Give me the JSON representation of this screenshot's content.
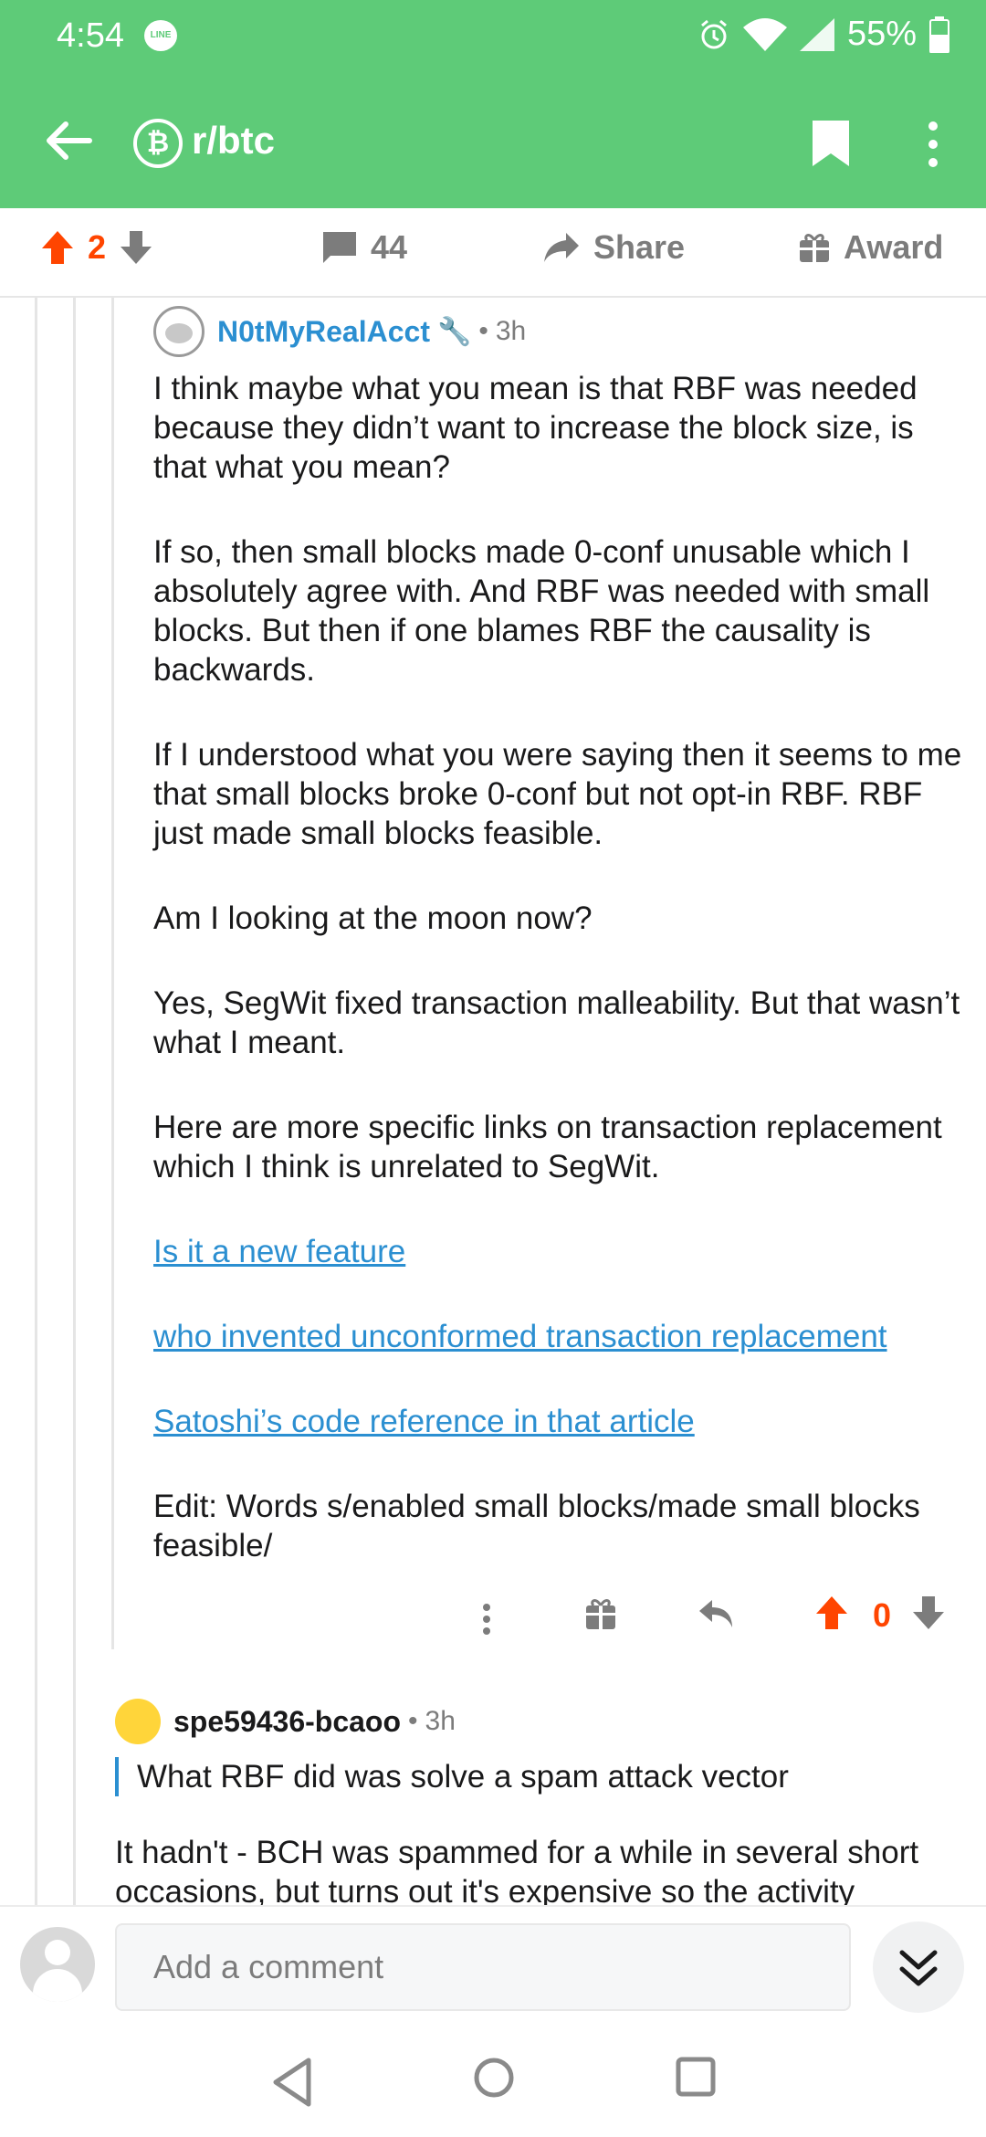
{
  "status_bar": {
    "time": "4:54",
    "notification_app": "LINE",
    "battery": "55%"
  },
  "toolbar": {
    "subreddit_icon_letter": "₿",
    "subreddit": "r/btc"
  },
  "post_actions": {
    "vote_count": "2",
    "comment_count": "44",
    "share_label": "Share",
    "award_label": "Award"
  },
  "comment1": {
    "author": "N0tMyRealAcct",
    "separator": "•",
    "age": "3h",
    "paragraphs": [
      "I think maybe what you mean is that RBF was needed because they didn’t want to increase the block size, is that what you mean?",
      "If so, then small blocks made 0-conf unusable which I absolutely agree with. And RBF was needed with small blocks. But then if one blames RBF the causality is backwards.",
      "If I understood what you were saying then it seems to me that small blocks broke 0-conf but not opt-in RBF. RBF just made small blocks feasible.",
      "Am I looking at the moon now?",
      "Yes, SegWit fixed transaction malleability. But that wasn’t what I meant.",
      "Here are more specific links on transaction replacement which I think is unrelated to SegWit."
    ],
    "links": [
      "Is it a new feature",
      "who invented unconformed transaction replacement",
      "Satoshi’s code reference in that article"
    ],
    "edit_note": "Edit: Words s/enabled small blocks/made small blocks feasible/",
    "vote_count": "0"
  },
  "comment2": {
    "author": "spe59436-bcaoo",
    "separator": "•",
    "age": "3h",
    "quote": "What RBF did was solve a spam attack vector",
    "body": "It hadn't - BCH was spammed for a while in several short occasions, but turns out it's expensive so the activity"
  },
  "comment_bar": {
    "placeholder": "Add a comment"
  },
  "colors": {
    "app_bar": "#5ecb78",
    "upvote": "#ff4500",
    "link": "#2b8fd1",
    "muted": "#7c7c7c"
  },
  "icons": [
    "back-arrow-icon",
    "bitcoin-icon",
    "bookmark-icon",
    "more-vert-icon",
    "upvote-icon",
    "downvote-icon",
    "comment-icon",
    "share-icon",
    "award-icon",
    "gift-icon",
    "reply-icon",
    "collapse-icon"
  ]
}
